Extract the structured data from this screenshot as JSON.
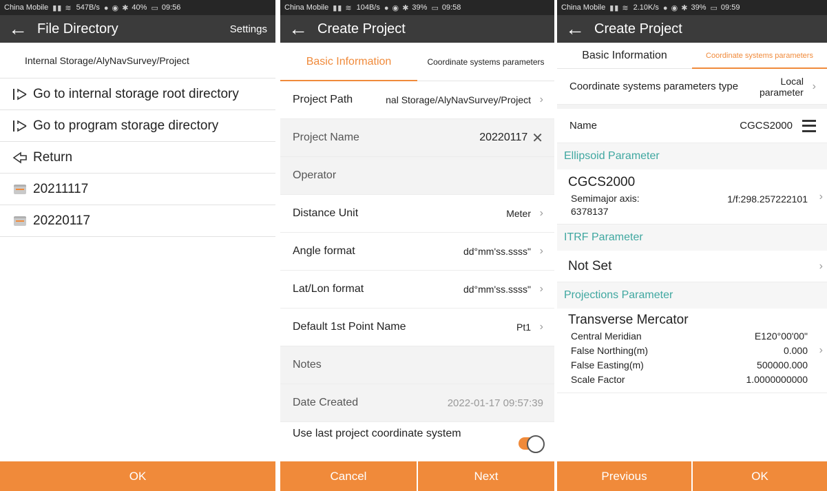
{
  "panel1": {
    "status": {
      "carrier": "China Mobile",
      "speed": "547B/s",
      "battery": "40%",
      "time": "09:56"
    },
    "title": "File Directory",
    "settings_label": "Settings",
    "path": "Internal Storage/AlyNavSurvey/Project",
    "items": [
      {
        "label": "Go to internal storage root directory",
        "icon": "go-root-icon"
      },
      {
        "label": "Go to program storage directory",
        "icon": "go-program-icon"
      },
      {
        "label": "Return",
        "icon": "return-icon"
      },
      {
        "label": "20211117",
        "icon": "folder-icon"
      },
      {
        "label": "20220117",
        "icon": "folder-icon"
      }
    ],
    "ok_label": "OK"
  },
  "panel2": {
    "status": {
      "carrier": "China Mobile",
      "speed": "104B/s",
      "battery": "39%",
      "time": "09:58"
    },
    "title": "Create Project",
    "tabs": [
      "Basic Information",
      "Coordinate systems parameters"
    ],
    "rows": {
      "project_path": {
        "label": "Project Path",
        "value": "nal Storage/AlyNavSurvey/Project"
      },
      "project_name": {
        "label": "Project Name",
        "value": "20220117"
      },
      "operator": {
        "label": "Operator",
        "value": ""
      },
      "distance_unit": {
        "label": "Distance Unit",
        "value": "Meter"
      },
      "angle_format": {
        "label": "Angle format",
        "value": "dd°mm'ss.ssss\""
      },
      "latlon_format": {
        "label": "Lat/Lon format",
        "value": "dd°mm'ss.ssss\""
      },
      "default_point": {
        "label": "Default 1st Point Name",
        "value": "Pt1"
      },
      "notes": {
        "label": "Notes",
        "value": ""
      },
      "date_created": {
        "label": "Date Created",
        "value": "2022-01-17 09:57:39"
      },
      "use_last": {
        "label": "Use last project coordinate system"
      }
    },
    "cancel_label": "Cancel",
    "next_label": "Next"
  },
  "panel3": {
    "status": {
      "carrier": "China Mobile",
      "speed": "2.10K/s",
      "battery": "39%",
      "time": "09:59"
    },
    "title": "Create Project",
    "tabs": [
      "Basic Information",
      "Coordinate systems parameters"
    ],
    "type_label": "Coordinate systems parameters type",
    "type_value": "Local parameters",
    "name_label": "Name",
    "name_value": "CGCS2000",
    "ellipsoid": {
      "header": "Ellipsoid Parameter",
      "name": "CGCS2000",
      "semimajor_label": "Semimajor axis:",
      "semimajor_value": "6378137",
      "flattening": "1/f:298.257222101"
    },
    "itrf": {
      "header": "ITRF Parameter",
      "value": "Not Set"
    },
    "projection": {
      "header": "Projections Parameter",
      "name": "Transverse Mercator",
      "rows": [
        {
          "k": "Central Meridian",
          "v": "E120°00'00\""
        },
        {
          "k": "False Northing(m)",
          "v": "0.000"
        },
        {
          "k": "False Easting(m)",
          "v": "500000.000"
        },
        {
          "k": "Scale Factor",
          "v": "1.0000000000"
        }
      ]
    },
    "previous_label": "Previous",
    "ok_label": "OK"
  }
}
